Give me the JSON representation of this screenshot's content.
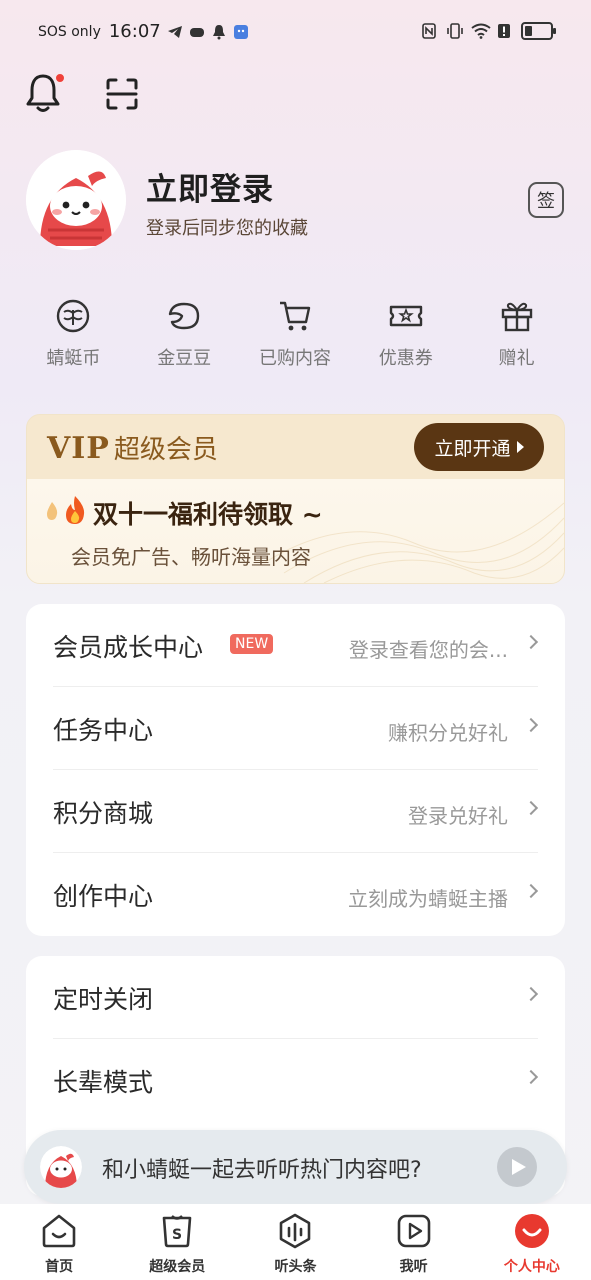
{
  "status_bar": {
    "carrier": "SOS only",
    "time": "16:07"
  },
  "profile": {
    "login_title": "立即登录",
    "login_subtitle": "登录后同步您的收藏",
    "sign_label": "签"
  },
  "quick_actions": [
    {
      "label": "蜻蜓币",
      "icon": "dragonfly-coin-icon"
    },
    {
      "label": "金豆豆",
      "icon": "bean-icon"
    },
    {
      "label": "已购内容",
      "icon": "cart-icon"
    },
    {
      "label": "优惠券",
      "icon": "coupon-icon"
    },
    {
      "label": "赠礼",
      "icon": "gift-icon"
    }
  ],
  "vip": {
    "tag": "VIP",
    "name": "超级会员",
    "button_label": "立即开通",
    "promo_title": "双十一福利待领取 ~",
    "promo_desc": "会员免广告、畅听海量内容"
  },
  "menu_group_1": [
    {
      "title": "会员成长中心",
      "badge": "NEW",
      "hint": "登录查看您的会..."
    },
    {
      "title": "任务中心",
      "hint": "赚积分兑好礼"
    },
    {
      "title": "积分商城",
      "hint": "登录兑好礼"
    },
    {
      "title": "创作中心",
      "hint": "立刻成为蜻蜓主播"
    }
  ],
  "menu_group_2": [
    {
      "title": "定时关闭",
      "hint": ""
    },
    {
      "title": "长辈模式",
      "hint": ""
    }
  ],
  "mini_player": {
    "text": "和小蜻蜓一起去听听热门内容吧?"
  },
  "tab_bar": [
    {
      "label": "首页",
      "icon": "home-icon",
      "active": false
    },
    {
      "label": "超级会员",
      "icon": "vip-bag-icon",
      "active": false
    },
    {
      "label": "听头条",
      "icon": "headlines-icon",
      "active": false
    },
    {
      "label": "我听",
      "icon": "play-square-icon",
      "active": false
    },
    {
      "label": "个人中心",
      "icon": "profile-icon",
      "active": true
    }
  ],
  "colors": {
    "accent": "#e8392f",
    "vip_brown": "#5a3613",
    "vip_gold": "#8a5a1e"
  }
}
